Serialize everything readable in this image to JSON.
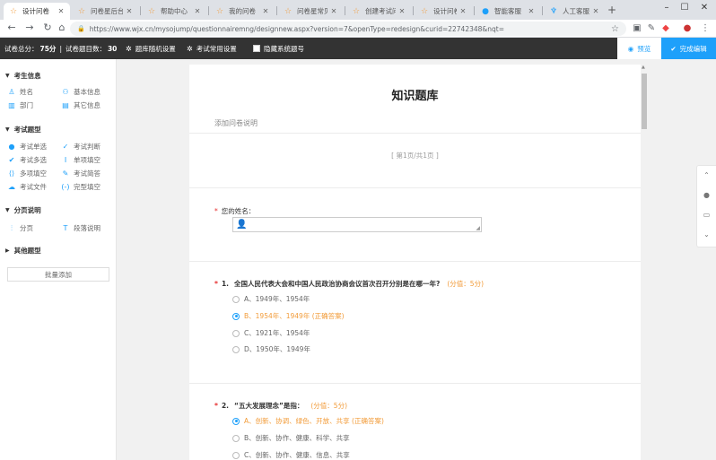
{
  "browser": {
    "tabs": [
      {
        "label": "设计问卷",
        "active": true
      },
      {
        "label": "问卷星后台"
      },
      {
        "label": "帮助中心"
      },
      {
        "label": "我的问卷"
      },
      {
        "label": "问卷星常见"
      },
      {
        "label": "创建考试问卷"
      },
      {
        "label": "设计问卷"
      },
      {
        "label": "智能客服"
      },
      {
        "label": "人工客服"
      }
    ],
    "url": "https://www.wjx.cn/mysojump/questionnairemng/designnew.aspx?version=7&openType=redesign&curid=22742348&nqt="
  },
  "appbar": {
    "total_score_label": "试卷总分：",
    "total_score_value": "75分",
    "question_count_label": "试卷题目数：",
    "question_count_value": "30",
    "random_setting": "题库随机设置",
    "exam_setting": "考试常用设置",
    "hide_numbers": "隐藏系统题号",
    "preview": "预览",
    "finish": "完成编辑"
  },
  "sidebar": {
    "candidate_info": {
      "title": "考生信息",
      "items": [
        "姓名",
        "基本信息",
        "部门",
        "其它信息"
      ]
    },
    "question_types": {
      "title": "考试题型",
      "items": [
        "考试单选",
        "考试判断",
        "考试多选",
        "单项填空",
        "多项填空",
        "考试简答",
        "考试文件",
        "完型填空"
      ]
    },
    "paging": {
      "title": "分页说明",
      "items": [
        "分页",
        "段落说明"
      ]
    },
    "other": {
      "title": "其他题型"
    },
    "batch_add": "批量添加"
  },
  "paper": {
    "title": "知识题库",
    "description_placeholder": "添加问卷说明",
    "page_indicator": "[ 第1页/共1页 ]",
    "name_question": "您的姓名：",
    "questions": [
      {
        "number": "1.",
        "text": "全国人民代表大会和中国人民政治协商会议首次召开分别是在哪一年?",
        "score": "(分值：5分)",
        "options": [
          {
            "label": "A、1949年、1954年",
            "selected": false
          },
          {
            "label": "B、1954年、1949年 (正确答案)",
            "selected": true
          },
          {
            "label": "C、1921年、1954年",
            "selected": false
          },
          {
            "label": "D、1950年、1949年",
            "selected": false
          }
        ]
      },
      {
        "number": "2.",
        "text": "“五大发展理念”是指：",
        "score": "(分值：5分)",
        "options": [
          {
            "label": "A、创新、协调、绿色、开放、共享 (正确答案)",
            "selected": true
          },
          {
            "label": "B、创新、协作、健康、科学、共享",
            "selected": false
          },
          {
            "label": "C、创新、协作、健康、信息、共享",
            "selected": false
          }
        ]
      }
    ]
  },
  "colors": {
    "accent": "#1ea0fa",
    "correct": "#f29b38",
    "required": "#e62e2e",
    "topbar": "#333333"
  }
}
